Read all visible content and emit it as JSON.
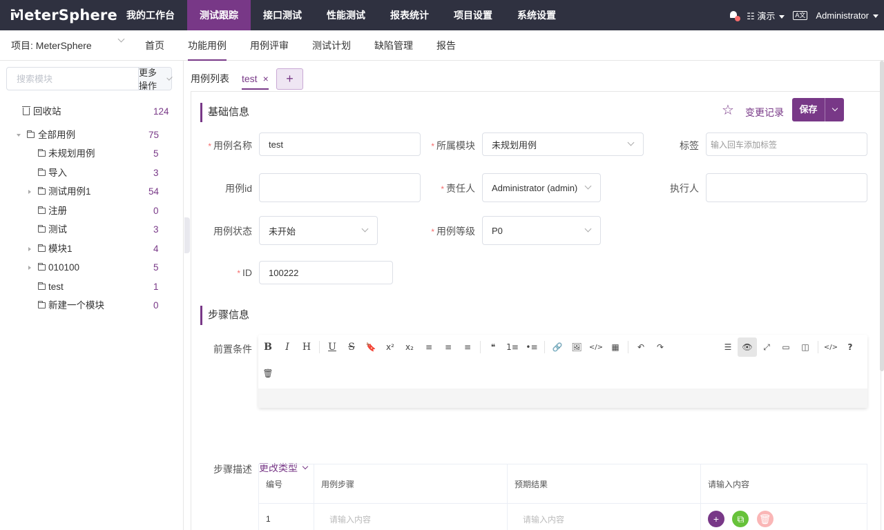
{
  "app": {
    "logo_text": "MeterSphere",
    "nav": [
      "我的工作台",
      "测试跟踪",
      "接口测试",
      "性能测试",
      "报表统计",
      "项目设置",
      "系统设置"
    ],
    "active_nav": "测试跟踪",
    "workspace": "演示",
    "user": "Administrator",
    "lang_icon": "lang-switch-icon"
  },
  "subnav": {
    "project": "项目: MeterSphere",
    "tabs": [
      "首页",
      "功能用例",
      "用例评审",
      "测试计划",
      "缺陷管理",
      "报告"
    ],
    "active_tab": "功能用例"
  },
  "sidebar": {
    "search_placeholder": "搜索模块",
    "more_ops": "更多操作",
    "recycle": {
      "label": "回收站",
      "count": "124"
    },
    "all": {
      "label": "全部用例",
      "count": "75"
    },
    "modules": [
      {
        "label": "未规划用例",
        "count": "5",
        "expandable": false
      },
      {
        "label": "导入",
        "count": "3",
        "expandable": false
      },
      {
        "label": "测试用例1",
        "count": "54",
        "expandable": true
      },
      {
        "label": "注册",
        "count": "0",
        "expandable": false
      },
      {
        "label": "测试",
        "count": "3",
        "expandable": false
      },
      {
        "label": "模块1",
        "count": "4",
        "expandable": true
      },
      {
        "label": "010100",
        "count": "5",
        "expandable": true
      },
      {
        "label": "test",
        "count": "1",
        "expandable": false
      },
      {
        "label": "新建一个模块",
        "count": "0",
        "expandable": false
      }
    ]
  },
  "tabs": {
    "list": "用例列表",
    "open": "test",
    "add": "+"
  },
  "form": {
    "basic_title": "基础信息",
    "change_log": "变更记录",
    "save": "保存",
    "name_label": "用例名称",
    "name_value": "test",
    "module_label": "所属模块",
    "module_value": "未规划用例",
    "tag_label": "标签",
    "tag_placeholder": "输入回车添加标签",
    "id_label": "用例id",
    "id_value": "",
    "owner_label": "责任人",
    "owner_value": "Administrator (admin)",
    "executor_label": "执行人",
    "executor_value": "",
    "status_label": "用例状态",
    "status_value": "未开始",
    "level_label": "用例等级",
    "level_value": "P0",
    "custom_id_label": "ID",
    "custom_id_value": "100222"
  },
  "steps": {
    "title": "步骤信息",
    "precondition_label": "前置条件",
    "desc_label": "步骤描述",
    "change_type": "更改类型",
    "columns": [
      "编号",
      "用例步骤",
      "预期结果",
      "请输入内容"
    ],
    "rows": [
      {
        "num": "1",
        "step_placeholder": "请输入内容",
        "result_placeholder": "请输入内容"
      }
    ]
  },
  "toolbar": {
    "row1": [
      "B",
      "I",
      "H",
      "U",
      "S",
      "🔖",
      "x²",
      "x₂",
      "≡",
      "≡",
      "≡",
      "❝",
      "1≡",
      "•≡",
      "🔗",
      "🖼",
      "</>",
      "▦",
      "↶",
      "↷"
    ],
    "row1_right": [
      "☰",
      "👁",
      "⤢",
      "▭",
      "◫",
      "</>",
      "?"
    ],
    "row2": [
      "🗑"
    ]
  }
}
